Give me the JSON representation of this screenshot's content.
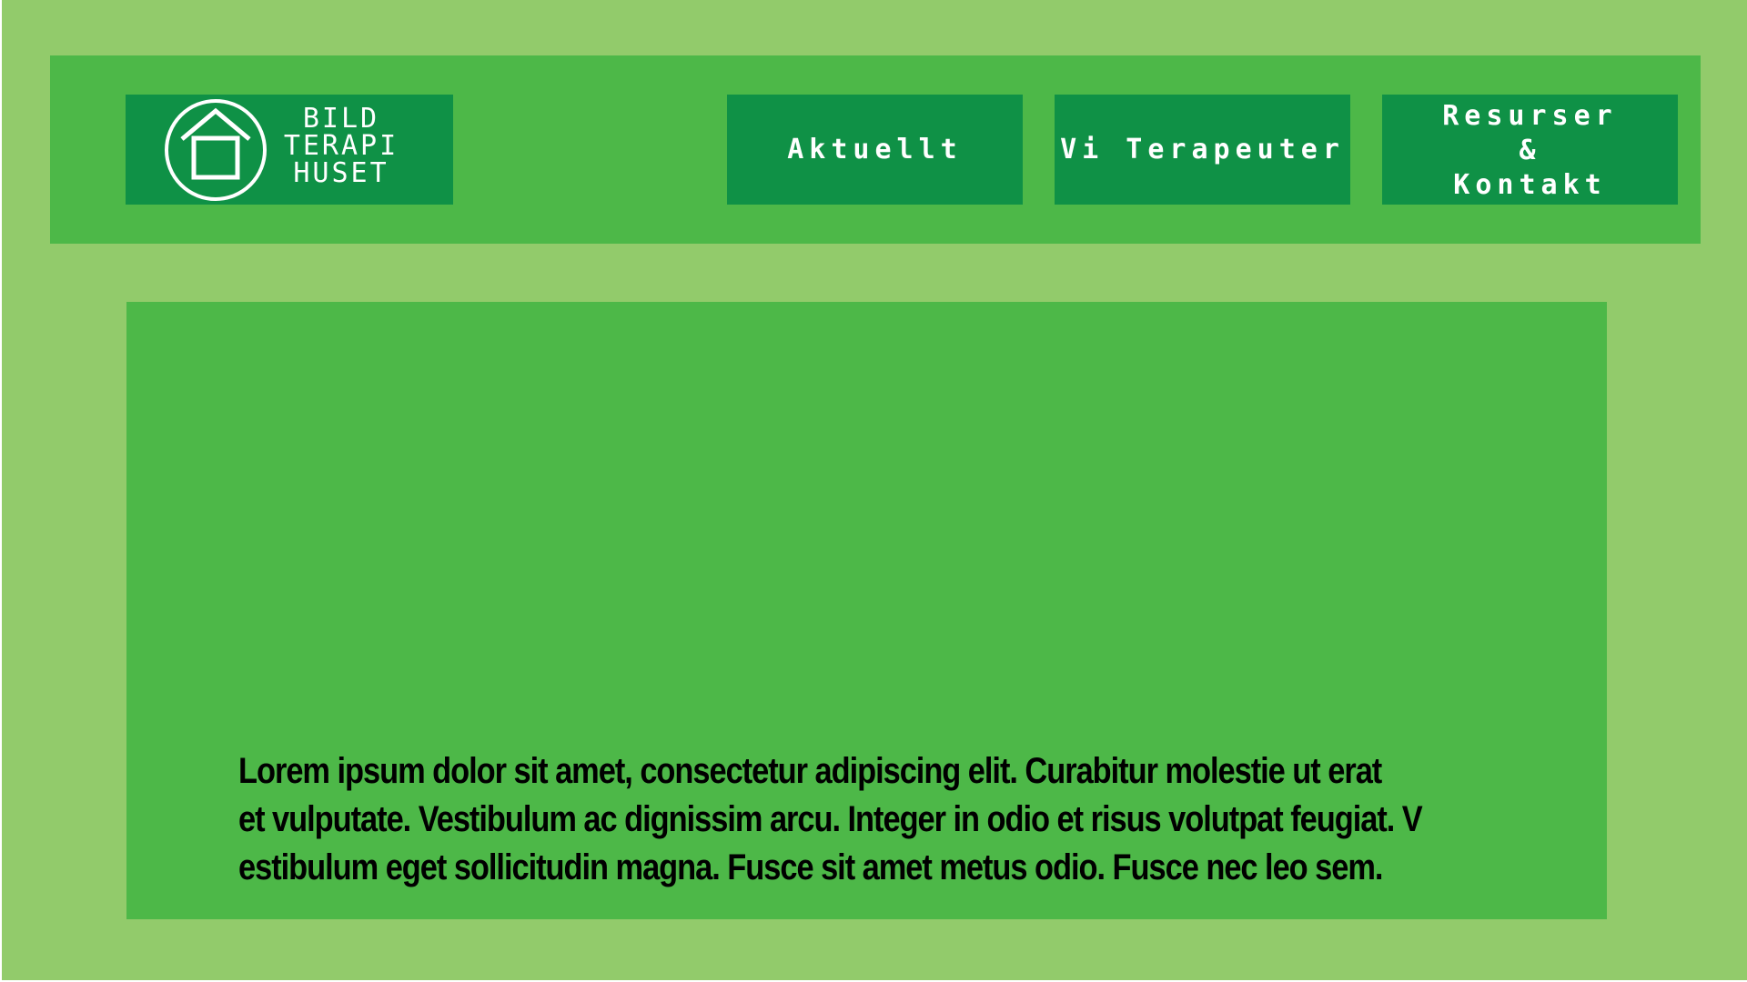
{
  "brand": {
    "logo_lines": [
      "BILD",
      "TERAPI",
      "HUSET"
    ],
    "logo_icon": "house-in-circle-icon"
  },
  "nav": {
    "items": [
      {
        "label": "Aktuellt"
      },
      {
        "label": "Vi Terapeuter"
      },
      {
        "label_lines": [
          "Resurser",
          "&",
          "Kontakt"
        ]
      }
    ]
  },
  "hero": {
    "lines": [
      "Lorem ipsum dolor sit amet, consectetur adipiscing elit. Curabitur molestie ut erat",
      "et vulputate. Vestibulum ac dignissim arcu. Integer in odio et risus volutpat feugiat. V",
      "estibulum eget sollicitudin magna. Fusce sit amet metus odio. Fusce nec leo sem."
    ]
  },
  "colors": {
    "page_background": "#92cb6b",
    "panel_background": "#4db848",
    "button_background": "#0f9146",
    "button_text": "#ffffff",
    "body_text": "#000000"
  }
}
